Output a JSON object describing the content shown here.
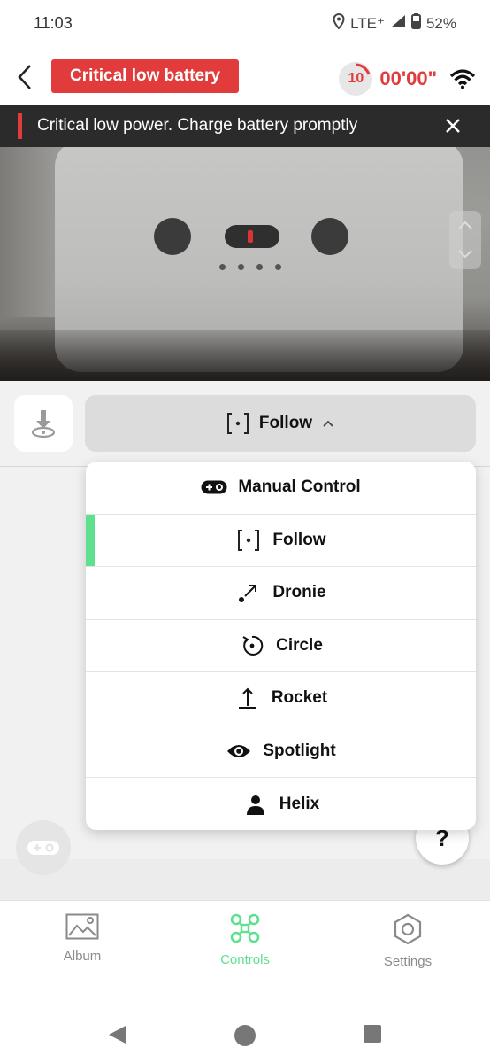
{
  "status_bar": {
    "time": "11:03",
    "network": "LTE⁺",
    "battery": "52%"
  },
  "top_bar": {
    "alert_chip": "Critical low battery",
    "timer_badge": "10",
    "timer_value": "00'00\""
  },
  "alert_banner": {
    "message": "Critical low power. Charge battery promptly"
  },
  "mode_selector": {
    "current": "Follow"
  },
  "mode_menu": {
    "items": [
      {
        "label": "Manual Control",
        "icon": "gamepad-icon",
        "selected": false
      },
      {
        "label": "Follow",
        "icon": "follow-icon",
        "selected": true
      },
      {
        "label": "Dronie",
        "icon": "dronie-icon",
        "selected": false
      },
      {
        "label": "Circle",
        "icon": "circle-orbit-icon",
        "selected": false
      },
      {
        "label": "Rocket",
        "icon": "rocket-icon",
        "selected": false
      },
      {
        "label": "Spotlight",
        "icon": "eye-icon",
        "selected": false
      },
      {
        "label": "Helix",
        "icon": "person-icon",
        "selected": false
      }
    ]
  },
  "help_button": {
    "label": "?"
  },
  "bottom_nav": {
    "items": [
      {
        "label": "Album",
        "icon": "album-icon",
        "active": false
      },
      {
        "label": "Controls",
        "icon": "drone-icon",
        "active": true
      },
      {
        "label": "Settings",
        "icon": "settings-hex-icon",
        "active": false
      }
    ]
  },
  "colors": {
    "alert_red": "#e23b3b",
    "accent_green": "#5fe08f",
    "banner_dark": "#2b2b2b"
  }
}
